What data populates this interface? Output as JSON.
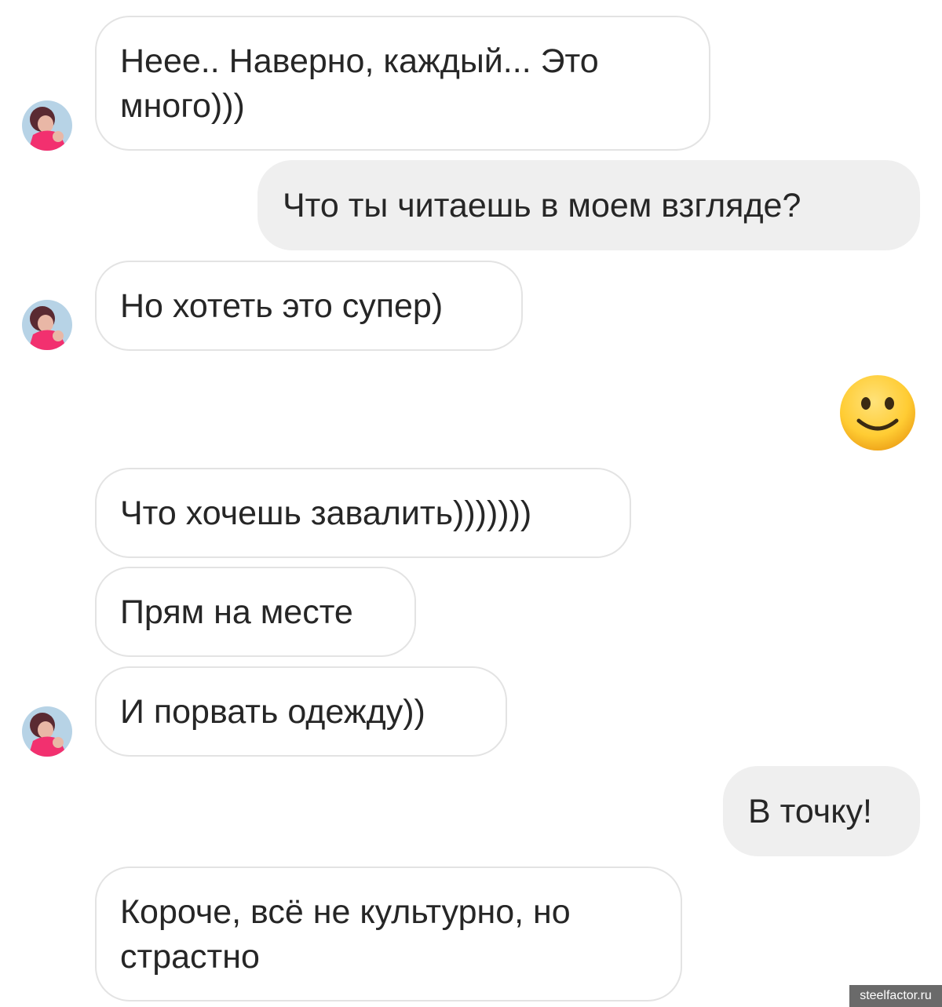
{
  "chat": {
    "messages": [
      {
        "sender": "them",
        "text": "Неее.. Наверно, каждый... Это много)))"
      },
      {
        "sender": "me",
        "text": "Что ты читаешь в моем взгляде?"
      },
      {
        "sender": "them",
        "text": "Но хотеть это супер)"
      },
      {
        "sender": "me",
        "emoji": "slightly-smiling-face"
      },
      {
        "sender": "them",
        "text": "Что хочешь завалить)))))))"
      },
      {
        "sender": "them",
        "text": "Прям на месте"
      },
      {
        "sender": "them",
        "text": "И порвать одежду))"
      },
      {
        "sender": "me",
        "text": "В точку!"
      },
      {
        "sender": "them",
        "text": "Короче, всё не культурно, но страстно"
      }
    ]
  },
  "watermark": "steelfactor.ru",
  "colors": {
    "incoming_bubble_border": "#e3e3e3",
    "outgoing_bubble_fill": "#efefef",
    "text": "#262626",
    "emoji_face": "#ffcc33"
  }
}
